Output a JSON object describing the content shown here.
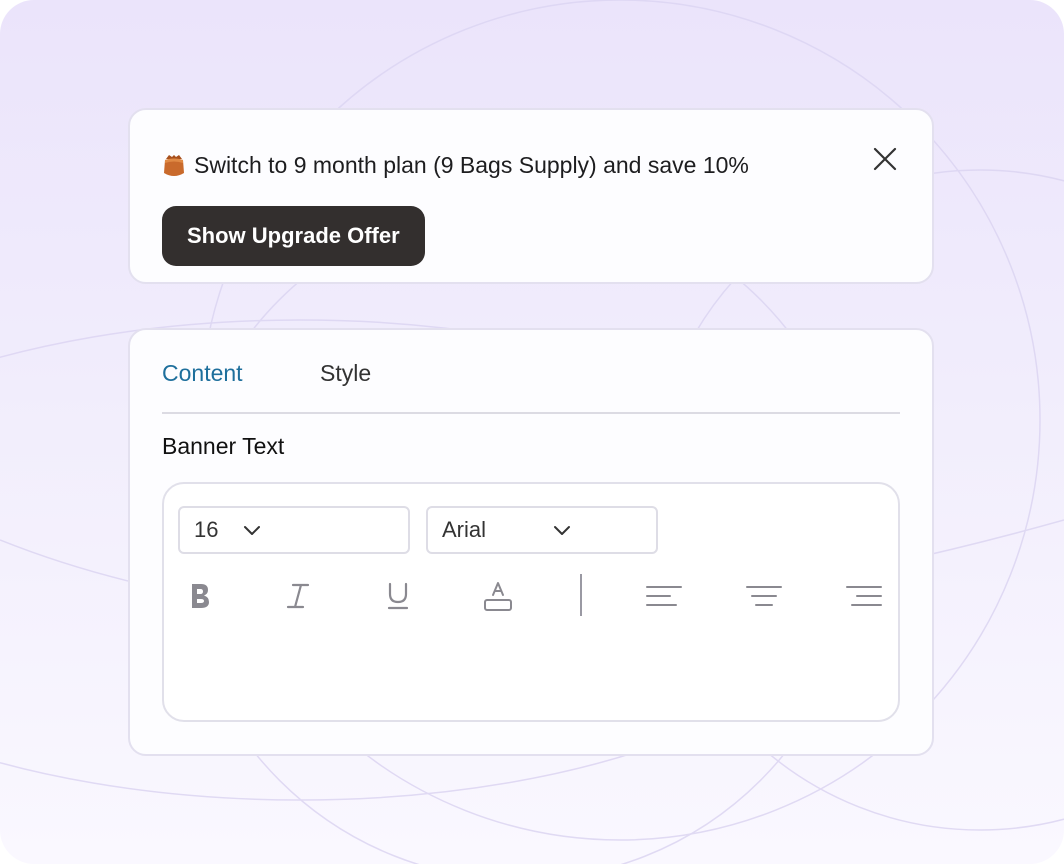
{
  "banner": {
    "icon": "shopping-bag-icon",
    "message": "Switch to 9 month plan (9 Bags Supply) and save 10%",
    "close_icon": "close-icon",
    "button_label": "Show Upgrade Offer"
  },
  "editor": {
    "tabs": [
      {
        "label": "Content",
        "active": true
      },
      {
        "label": "Style",
        "active": false
      }
    ],
    "section_label": "Banner Text",
    "font_size": "16",
    "font_family": "Arial",
    "toolbar": [
      "bold-icon",
      "italic-icon",
      "underline-icon",
      "text-color-icon",
      "align-left-icon",
      "align-center-icon",
      "align-right-icon"
    ]
  },
  "colors": {
    "accent_tab": "#1e6f9c",
    "button_bg": "#332f2e",
    "icon_bag": "#c96a2c",
    "background": "#ebe4fb"
  }
}
